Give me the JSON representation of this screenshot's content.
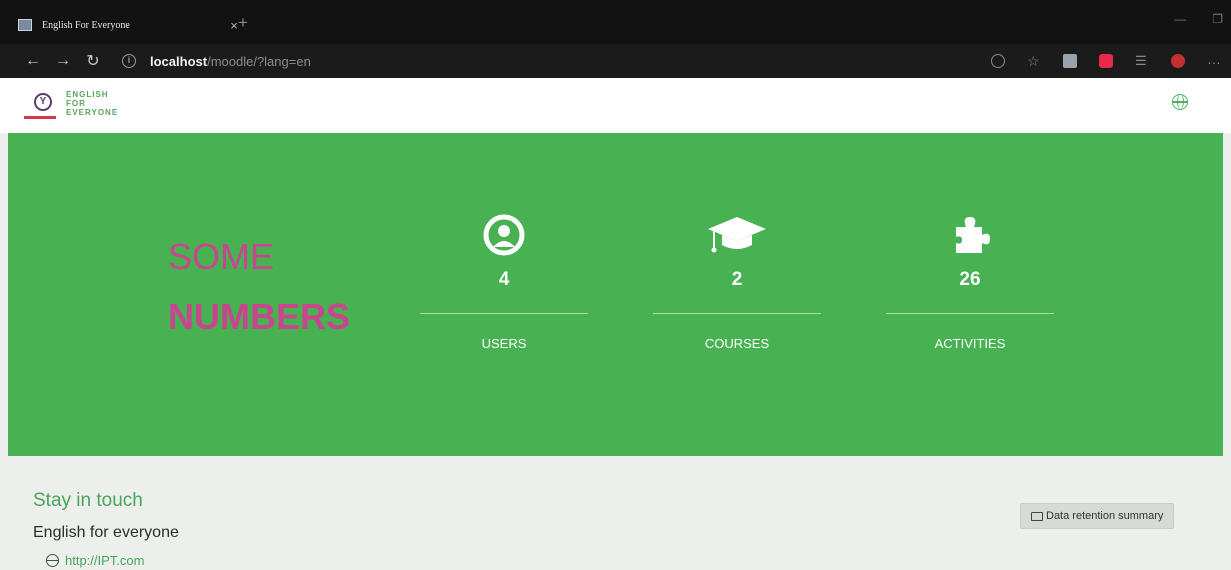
{
  "browser": {
    "tab_title": "English For Everyone",
    "tab_close": "×",
    "new_tab": "+",
    "url_host": "localhost",
    "url_path": "/moodle/?lang=en",
    "icons": [
      "back-icon",
      "forward-icon",
      "refresh-icon",
      "info-icon",
      "zoom-icon",
      "star-icon",
      "extension-icon",
      "extension-icon",
      "favorites-icon",
      "profile-avatar",
      "more-icon"
    ]
  },
  "header": {
    "logo_lines": [
      "ENGLISH",
      "FOR",
      "EVERYONE"
    ],
    "language_icon": "globe-icon"
  },
  "stats": {
    "heading_line1": "SOME",
    "heading_line2": "NUMBERS",
    "heading_color": "#c9458f",
    "band_color": "#48b151",
    "items": [
      {
        "icon": "user-icon",
        "value": "4",
        "label": "USERS"
      },
      {
        "icon": "graduation-cap-icon",
        "value": "2",
        "label": "COURSES"
      },
      {
        "icon": "puzzle-icon",
        "value": "26",
        "label": "ACTIVITIES"
      }
    ]
  },
  "footer": {
    "title": "Stay in touch",
    "org": "English for everyone",
    "link": "http://IPT.com",
    "data_retention": "Data retention summary"
  }
}
